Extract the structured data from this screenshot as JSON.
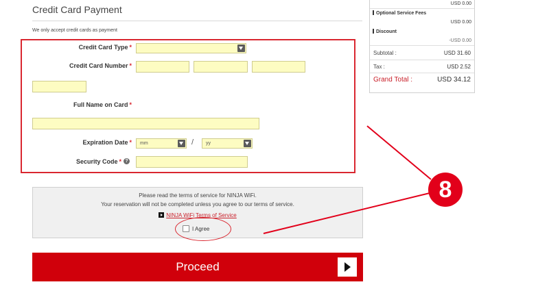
{
  "page": {
    "title": "Credit Card Payment",
    "note": "We only accept credit cards as payment"
  },
  "form": {
    "required_mark": "*",
    "card_type": {
      "label": "Credit Card Type",
      "value": ""
    },
    "card_number": {
      "label": "Credit Card Number"
    },
    "full_name": {
      "label": "Full Name on Card"
    },
    "expiration": {
      "label": "Expiration Date",
      "month_placeholder": "mm",
      "year_placeholder": "yy",
      "separator": "/"
    },
    "security_code": {
      "label": "Security Code",
      "help_icon": "?"
    }
  },
  "terms": {
    "line1": "Please read the terms of service for NINJA WiFi.",
    "line2": "Your reservation will not be completed unless you agree to our terms of service.",
    "link_label": "NINJA WiFi Terms of Service",
    "agree_label": "I Agree",
    "agree_checked": false
  },
  "proceed": {
    "label": "Proceed"
  },
  "summary": {
    "top_value": "USD 0.00",
    "optional_fees_label": "Optional Service Fees",
    "optional_fees_value": "USD 0.00",
    "discount_label": "Discount",
    "discount_value": "-USD 0.00",
    "subtotal_label": "Subtotal :",
    "subtotal_value": "USD 31.60",
    "tax_label": "Tax :",
    "tax_value": "USD 2.52",
    "grand_label": "Grand Total :",
    "grand_value": "USD 34.12"
  },
  "annotation": {
    "step_number": "8"
  },
  "colors": {
    "accent": "#d0000b",
    "annotation_red": "#e2001a",
    "field_fill": "#fdfcc2"
  }
}
